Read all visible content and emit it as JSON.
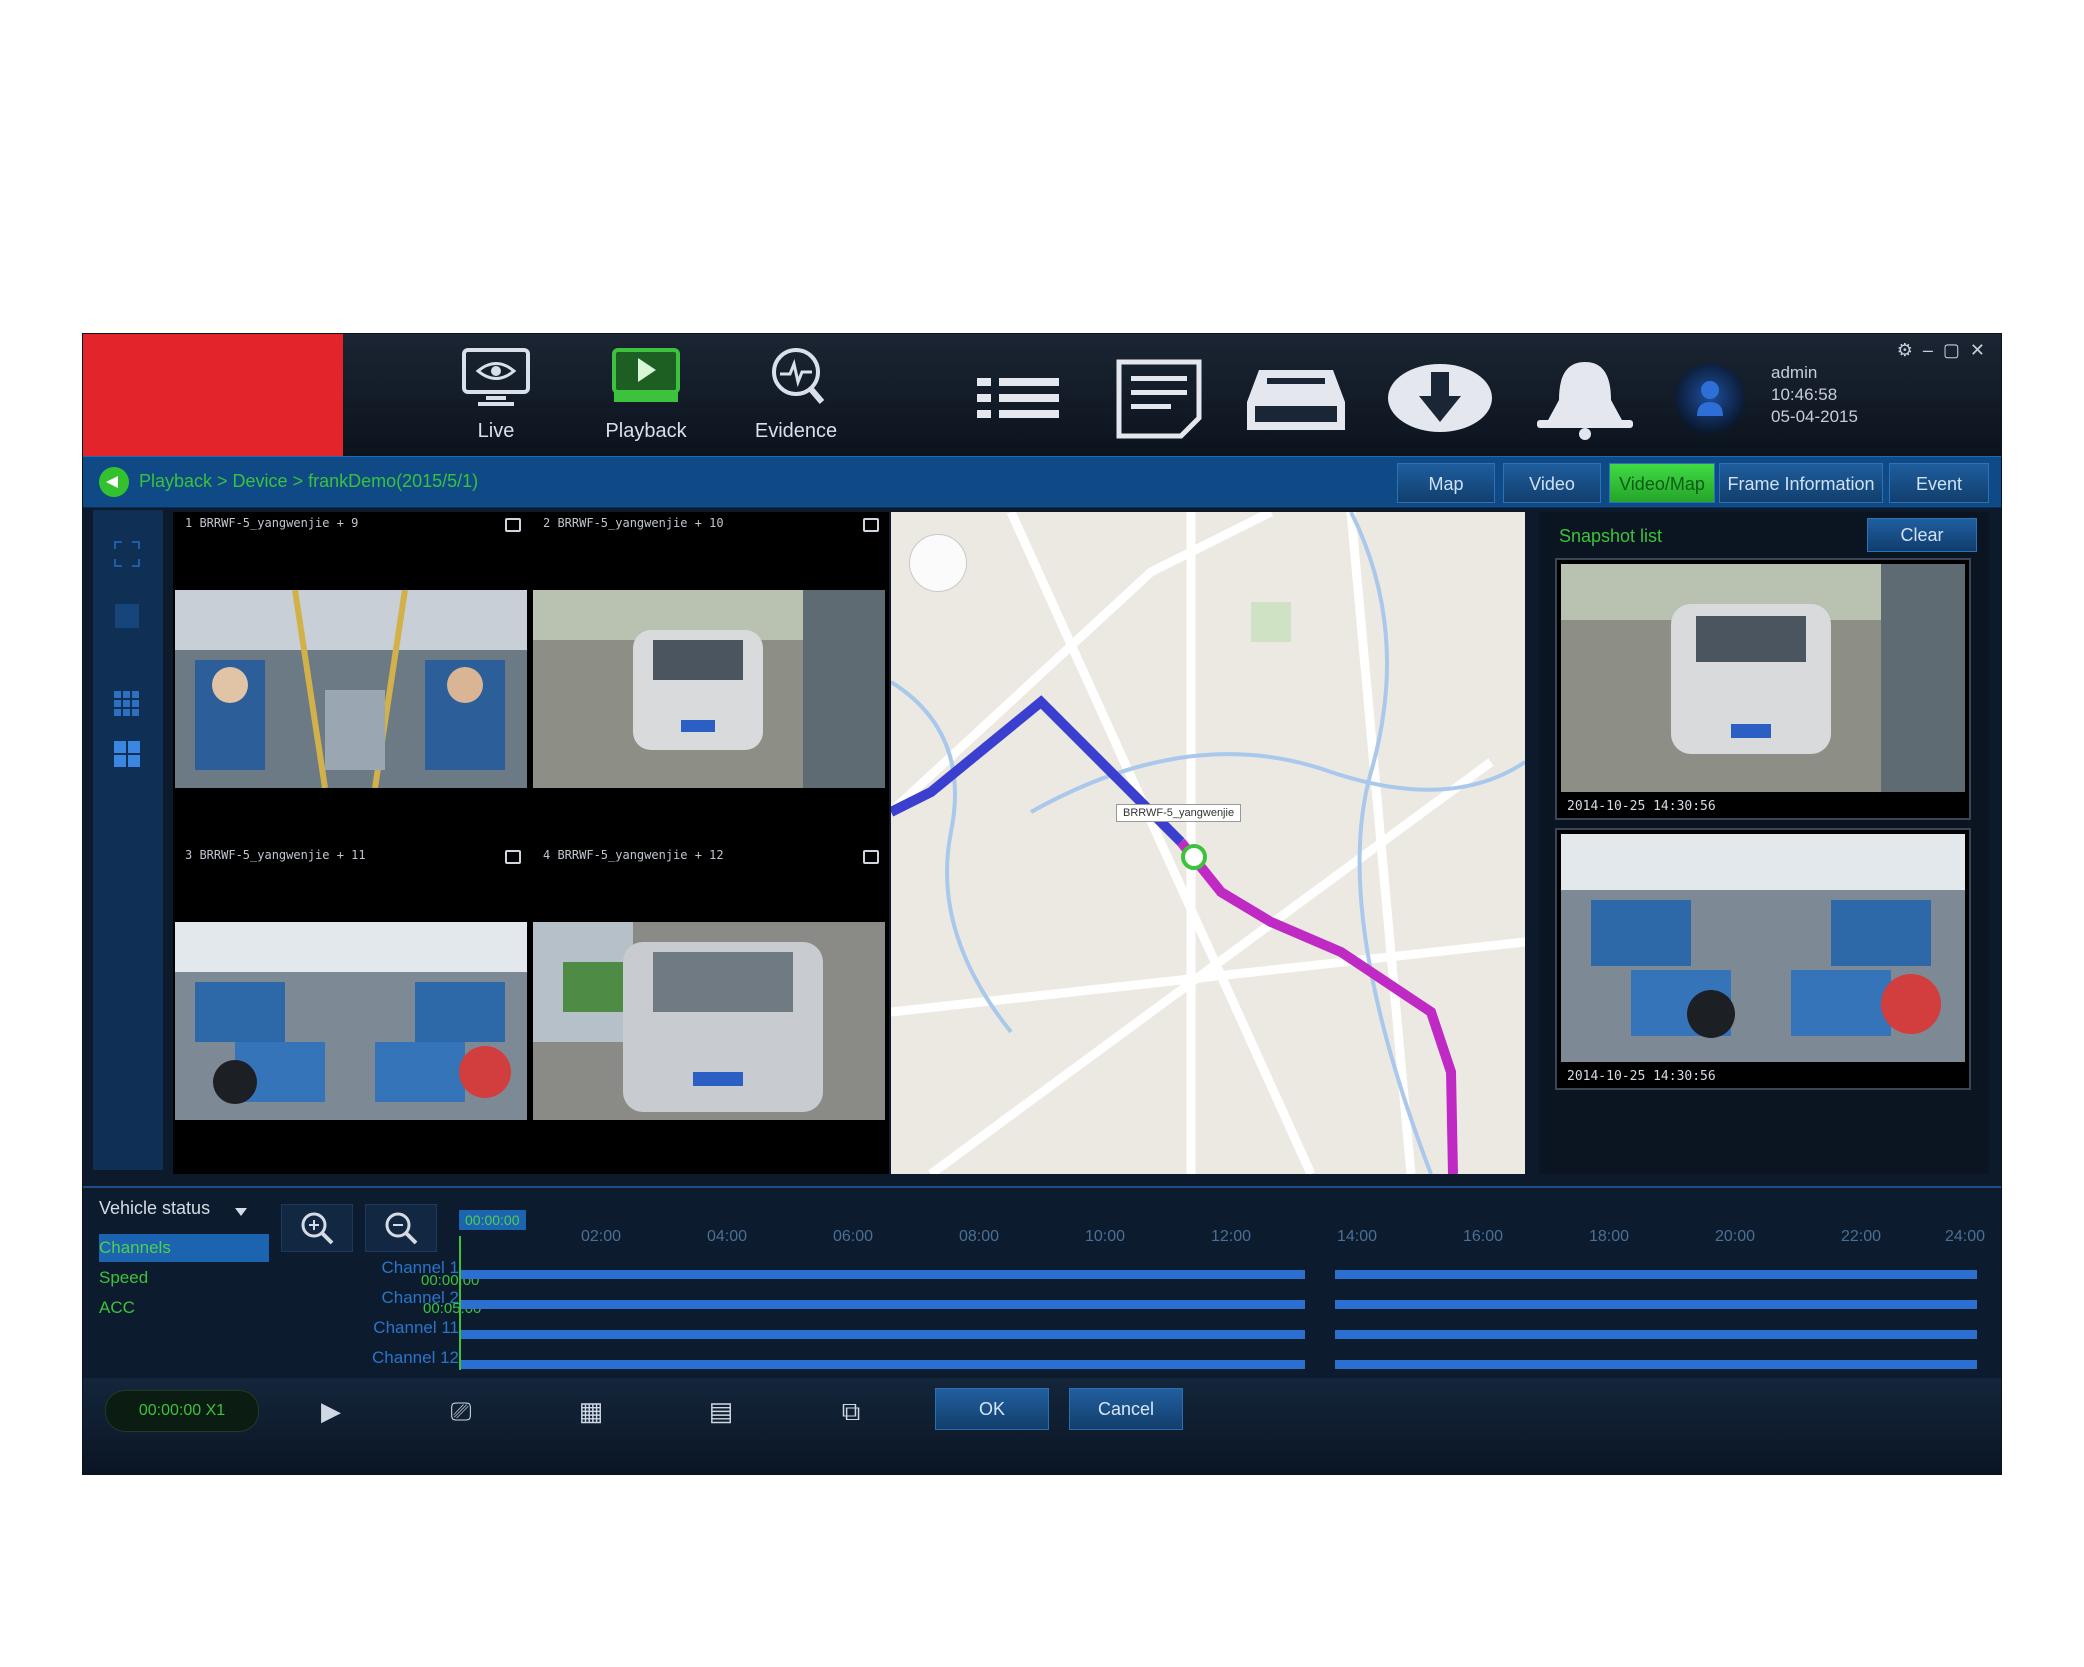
{
  "topbar": {
    "modules": [
      {
        "label": "Live",
        "icon": "monitor-eye-icon"
      },
      {
        "label": "Playback",
        "icon": "monitor-play-icon"
      },
      {
        "label": "Evidence",
        "icon": "evidence-magnifier-icon"
      }
    ],
    "toolbar_icons": [
      "list-icon",
      "report-icon",
      "storage-icon",
      "download-icon",
      "bell-icon"
    ],
    "user": {
      "name": "admin",
      "time": "10:46:58",
      "date": "05-04-2015"
    },
    "window_controls": [
      "settings-icon",
      "minimize-icon",
      "maximize-icon",
      "close-icon"
    ]
  },
  "nav": {
    "breadcrumb": "Playback > Device > frankDemo(2015/5/1)",
    "tabs": [
      {
        "label": "Map",
        "active": false
      },
      {
        "label": "Video",
        "active": false
      },
      {
        "label": "Video/Map",
        "active": true
      },
      {
        "label": "Frame Information",
        "active": false
      },
      {
        "label": "Event",
        "active": false
      }
    ]
  },
  "video_tiles": [
    {
      "caption": "1 BRRWF-5_yangwenjie + 9"
    },
    {
      "caption": "2 BRRWF-5_yangwenjie + 10"
    },
    {
      "caption": "3 BRRWF-5_yangwenjie + 11"
    },
    {
      "caption": "4 BRRWF-5_yangwenjie + 12"
    }
  ],
  "map": {
    "vehicle_label": "BRRWF-5_yangwenjie"
  },
  "snapshot": {
    "title": "Snapshot list",
    "clear_label": "Clear",
    "items": [
      {
        "timestamp": "2014-10-25 14:30:56"
      },
      {
        "timestamp": "2014-10-25 14:30:56"
      }
    ]
  },
  "timeline": {
    "vehicle_status_label": "Vehicle status",
    "status_items": [
      {
        "label": "Channels",
        "selected": true
      },
      {
        "label": "Speed",
        "selected": false
      },
      {
        "label": "ACC",
        "selected": false
      }
    ],
    "start_time": "00:00:00",
    "ticks": [
      "02:00",
      "04:00",
      "06:00",
      "08:00",
      "10:00",
      "12:00",
      "14:00",
      "16:00",
      "18:00",
      "20:00",
      "22:00",
      "24:00"
    ],
    "channels": [
      {
        "label": "Channel 1",
        "time": "00:00:00"
      },
      {
        "label": "Channel 2",
        "time": "00:05:00"
      },
      {
        "label": "Channel 11",
        "time": ""
      },
      {
        "label": "Channel 12",
        "time": ""
      }
    ]
  },
  "bottombar": {
    "clock": "00:00:00  X1",
    "ok_label": "OK",
    "cancel_label": "Cancel",
    "icons": [
      "play-icon",
      "clip-icon",
      "channel-select-icon",
      "all-channels-icon",
      "export-icon"
    ]
  },
  "colors": {
    "accent_green": "#3cc23c",
    "active_blue": "#1c63b0",
    "logo_red": "#e3242b",
    "route_blue": "#3b3fd0",
    "route_purple": "#c02ac4"
  }
}
